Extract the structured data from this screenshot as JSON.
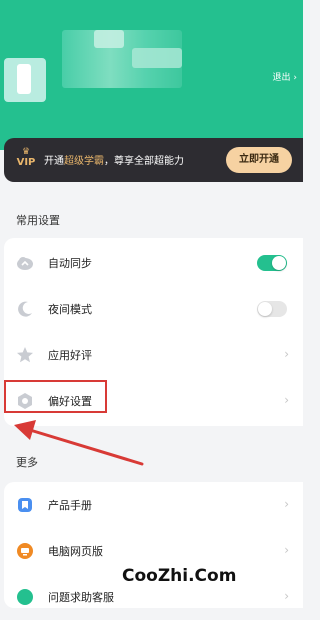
{
  "header": {
    "logout_label": "退出 ›"
  },
  "vip": {
    "badge": "VIP",
    "promo_prefix": "开通",
    "promo_highlight": "超级学霸",
    "promo_suffix": "，尊享全部超能力",
    "button_label": "立即开通"
  },
  "common_settings": {
    "title": "常用设置",
    "items": [
      {
        "label": "自动同步",
        "icon": "cloud-sync-icon",
        "control": "toggle",
        "checked": true
      },
      {
        "label": "夜间模式",
        "icon": "moon-icon",
        "control": "toggle",
        "checked": false
      },
      {
        "label": "应用好评",
        "icon": "star-icon",
        "control": "chevron",
        "chevron": "›"
      },
      {
        "label": "偏好设置",
        "icon": "settings-gear-icon",
        "control": "chevron",
        "chevron": "›"
      }
    ]
  },
  "more": {
    "title": "更多",
    "items": [
      {
        "label": "产品手册",
        "icon": "manual-icon",
        "chevron": "›"
      },
      {
        "label": "电脑网页版",
        "icon": "web-version-icon",
        "chevron": "›"
      },
      {
        "label": "问题求助客服",
        "icon": "help-icon",
        "chevron": "›"
      }
    ]
  },
  "watermark": "CooZhi.Com",
  "colors": {
    "brand": "#24c08f",
    "annotation_red": "#d83a36",
    "vip_gold": "#e9b66c"
  }
}
